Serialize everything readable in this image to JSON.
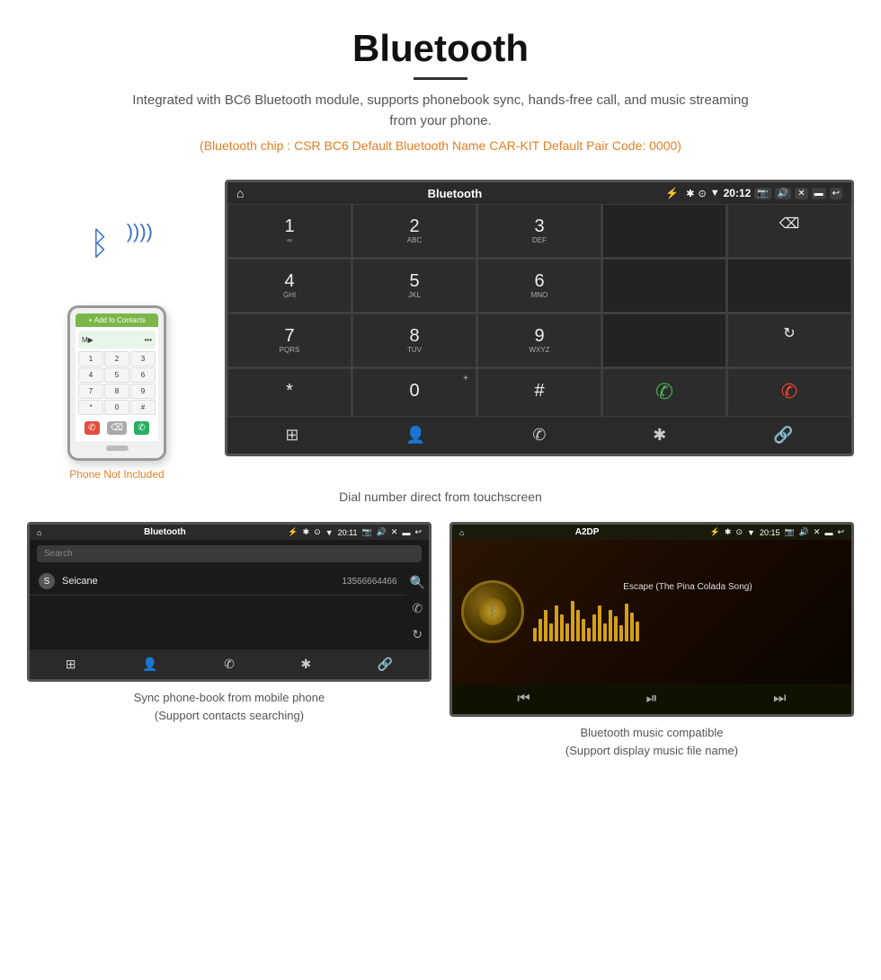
{
  "page": {
    "title": "Bluetooth",
    "description": "Integrated with BC6 Bluetooth module, supports phonebook sync, hands-free call, and music streaming from your phone.",
    "specs": "(Bluetooth chip : CSR BC6    Default Bluetooth Name CAR-KIT    Default Pair Code: 0000)",
    "caption_main": "Dial number direct from touchscreen",
    "caption_phonebook": "Sync phone-book from mobile phone",
    "caption_phonebook_sub": "(Support contacts searching)",
    "caption_music": "Bluetooth music compatible",
    "caption_music_sub": "(Support display music file name)"
  },
  "main_screen": {
    "status_bar": {
      "home_icon": "⌂",
      "title": "Bluetooth",
      "usb_icon": "⚡",
      "time": "20:12",
      "icons": [
        "✱",
        "⊙",
        "▼",
        "📷",
        "🔊",
        "✕",
        "▬",
        "↩"
      ]
    },
    "dialpad": [
      {
        "key": "1",
        "sub": "∞",
        "type": "normal"
      },
      {
        "key": "2",
        "sub": "ABC",
        "type": "normal"
      },
      {
        "key": "3",
        "sub": "DEF",
        "type": "normal"
      },
      {
        "key": "",
        "sub": "",
        "type": "empty"
      },
      {
        "key": "⌫",
        "sub": "",
        "type": "backspace"
      },
      {
        "key": "4",
        "sub": "GHI",
        "type": "normal"
      },
      {
        "key": "5",
        "sub": "JKL",
        "type": "normal"
      },
      {
        "key": "6",
        "sub": "MNO",
        "type": "normal"
      },
      {
        "key": "",
        "sub": "",
        "type": "empty"
      },
      {
        "key": "",
        "sub": "",
        "type": "empty"
      },
      {
        "key": "7",
        "sub": "PQRS",
        "type": "normal"
      },
      {
        "key": "8",
        "sub": "TUV",
        "type": "normal"
      },
      {
        "key": "9",
        "sub": "WXYZ",
        "type": "normal"
      },
      {
        "key": "",
        "sub": "",
        "type": "empty"
      },
      {
        "key": "↻",
        "sub": "",
        "type": "refresh"
      },
      {
        "key": "*",
        "sub": "",
        "type": "normal"
      },
      {
        "key": "0",
        "sub": "+",
        "type": "normal"
      },
      {
        "key": "#",
        "sub": "",
        "type": "normal"
      },
      {
        "key": "✆",
        "sub": "",
        "type": "green"
      },
      {
        "key": "✆",
        "sub": "",
        "type": "red"
      }
    ],
    "bottom_nav": [
      "⊞",
      "👤",
      "✆",
      "✱",
      "🔗"
    ]
  },
  "phonebook_screen": {
    "status_bar": {
      "home_icon": "⌂",
      "title": "Bluetooth",
      "usb_icon": "⚡",
      "time": "20:11"
    },
    "search_placeholder": "Search",
    "contacts": [
      {
        "letter": "S",
        "name": "Seicane",
        "number": "13566664466"
      }
    ],
    "side_icons": [
      "🔍",
      "✆",
      "↻"
    ],
    "bottom_nav": [
      "⊞",
      "👤",
      "✆",
      "✱",
      "🔗"
    ]
  },
  "music_screen": {
    "status_bar": {
      "home_icon": "⌂",
      "title": "A2DP",
      "usb_icon": "⚡",
      "time": "20:15"
    },
    "song_name": "Escape (The Pina Colada Song)",
    "bt_icon": "✱",
    "controls": [
      "⏮",
      "⏯",
      "⏭"
    ]
  },
  "phone_section": {
    "not_included": "Phone Not Included"
  }
}
